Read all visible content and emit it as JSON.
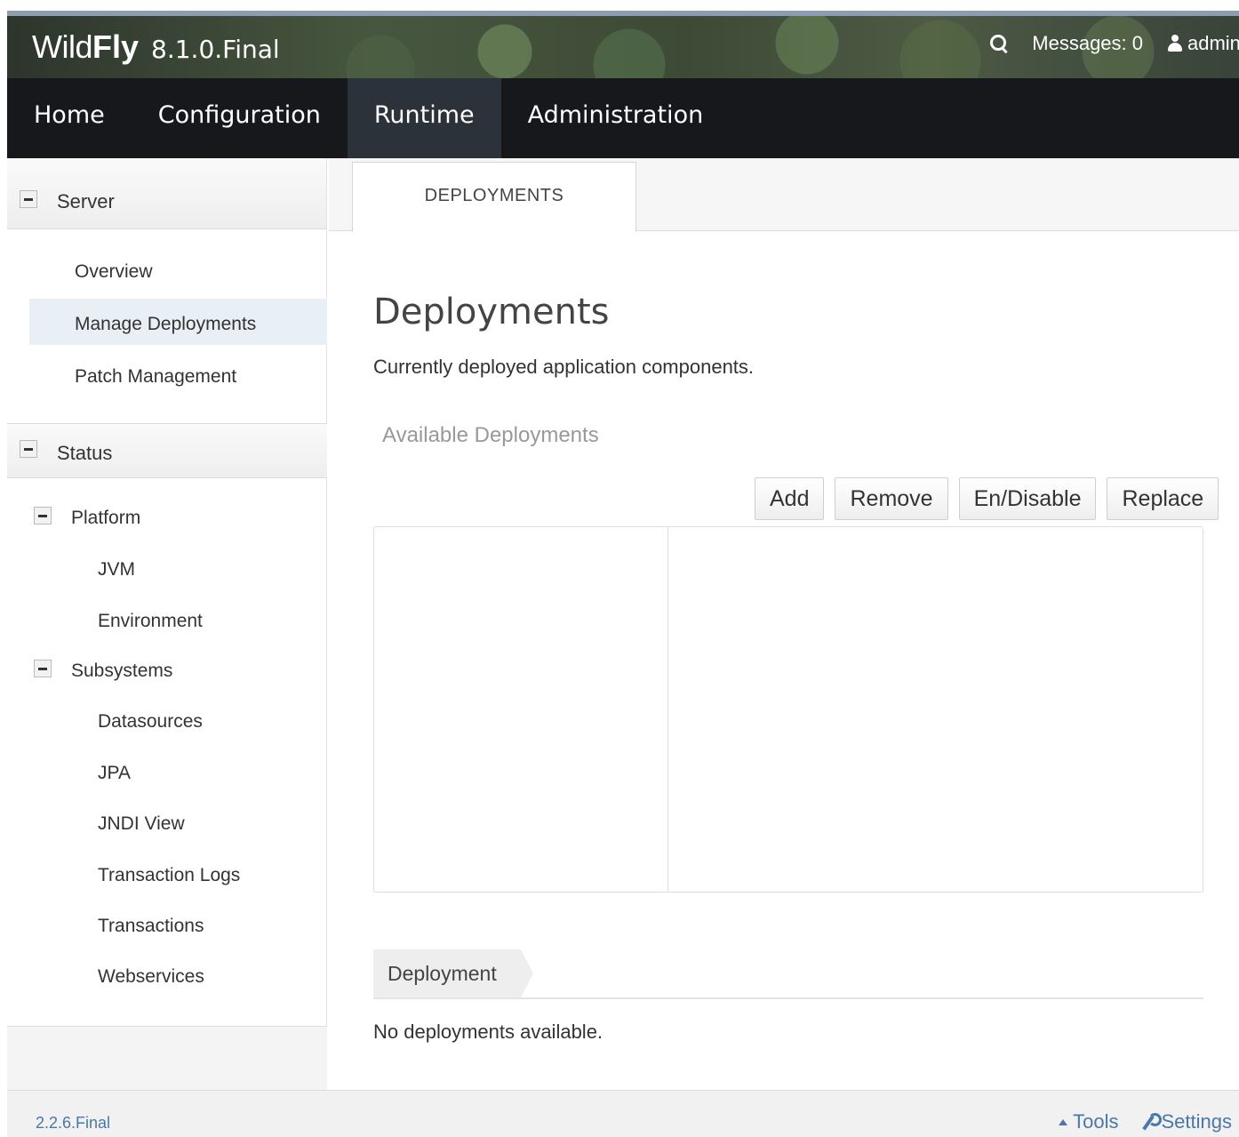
{
  "header": {
    "brand_wild": "Wild",
    "brand_fly": "Fly",
    "version": "8.1.0.Final",
    "messages_label": "Messages: 0",
    "user_label": "admin"
  },
  "nav": {
    "items": [
      {
        "label": "Home"
      },
      {
        "label": "Configuration"
      },
      {
        "label": "Runtime"
      },
      {
        "label": "Administration"
      }
    ],
    "active": "Runtime"
  },
  "sidebar": {
    "server_label": "Server",
    "server_items": [
      "Overview",
      "Manage Deployments",
      "Patch Management"
    ],
    "selected": "Manage Deployments",
    "status_label": "Status",
    "platform_label": "Platform",
    "platform_items": [
      "JVM",
      "Environment"
    ],
    "subsystems_label": "Subsystems",
    "subsystem_items": [
      "Datasources",
      "JPA",
      "JNDI View",
      "Transaction Logs",
      "Transactions",
      "Webservices"
    ]
  },
  "content": {
    "tab_label": "DEPLOYMENTS",
    "title": "Deployments",
    "description": "Currently deployed application components.",
    "section_title": "Available Deployments",
    "buttons": {
      "add": "Add",
      "remove": "Remove",
      "endisable": "En/Disable",
      "replace": "Replace"
    },
    "deployment_tab": "Deployment",
    "empty_message": "No deployments available."
  },
  "footer": {
    "version": "2.2.6.Final",
    "tools": "Tools",
    "settings": "Settings"
  },
  "colors": {
    "nav_bg": "#16181b",
    "nav_active": "#2b3239",
    "link": "#4a78a8",
    "selected_bg": "#e8f0f6"
  }
}
